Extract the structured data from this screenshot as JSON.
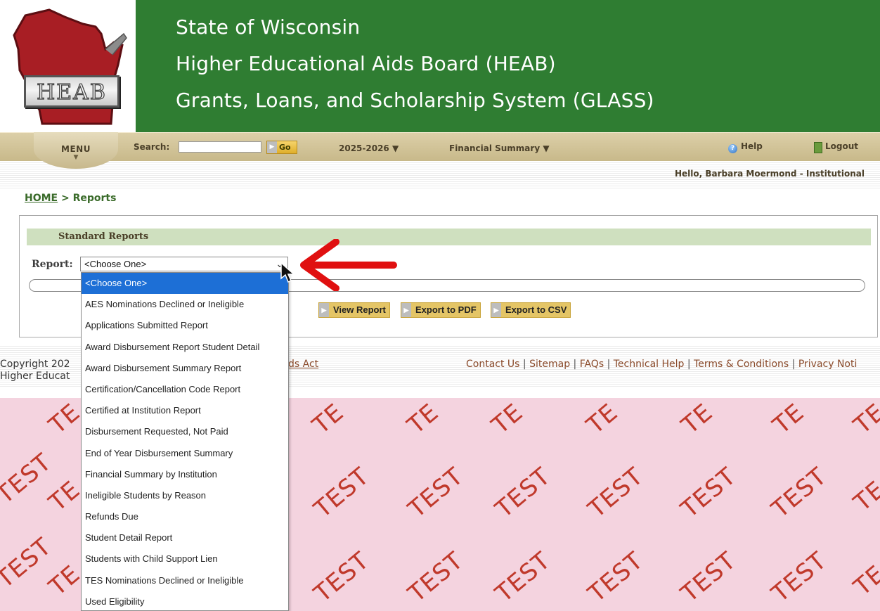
{
  "header": {
    "logo_text": "HEAB",
    "title_lines": [
      "State of Wisconsin",
      "Higher Educational Aids Board (HEAB)",
      "Grants, Loans, and Scholarship System (GLASS)"
    ],
    "colors": {
      "banner": "#2f7d32",
      "state_shape": "#a81e24"
    }
  },
  "nav": {
    "menu_label": "MENU",
    "menu_caret": "▼",
    "search_label": "Search:",
    "search_value": "",
    "go_label": "Go",
    "year_label": "2025-2026 ▼",
    "financial_label": "Financial Summary ▼",
    "help_label": "Help",
    "logout_label": "Logout",
    "greeting": "Hello, Barbara Moermond - Institutional"
  },
  "breadcrumb": {
    "home": "HOME",
    "separator": " > ",
    "current": "Reports"
  },
  "reports": {
    "section_title": "Standard Reports",
    "report_label": "Report:",
    "selected_value": "<Choose One>",
    "options": [
      "<Choose One>",
      "AES Nominations Declined or Ineligible",
      "Applications Submitted Report",
      "Award Disbursement Report Student Detail",
      "Award Disbursement Summary Report",
      "Certification/Cancellation Code Report",
      "Certified at Institution Report",
      "Disbursement Requested, Not Paid",
      "End of Year Disbursement Summary",
      "Financial Summary by Institution",
      "Ineligible Students by Reason",
      "Refunds Due",
      "Student Detail Report",
      "Students with Child Support Lien",
      "TES Nominations Declined or Ineligible",
      "Used Eligibility"
    ],
    "buttons": {
      "view": "View Report",
      "pdf": "Export to PDF",
      "csv": "Export to CSV"
    }
  },
  "footer": {
    "copyright_line1": "Copyright 202",
    "copyright_line2": "Higher Educat",
    "act_link": "ds Act",
    "links": [
      "Contact Us",
      "Sitemap",
      "FAQs",
      "Technical Help",
      "Terms & Conditions",
      "Privacy Noti"
    ]
  },
  "watermark": {
    "text": "TEST",
    "partial_text": "TE",
    "colors": {
      "background": "#f4d3df",
      "text": "#c0392b"
    }
  },
  "annotation": {
    "arrow_color": "#e01010"
  }
}
